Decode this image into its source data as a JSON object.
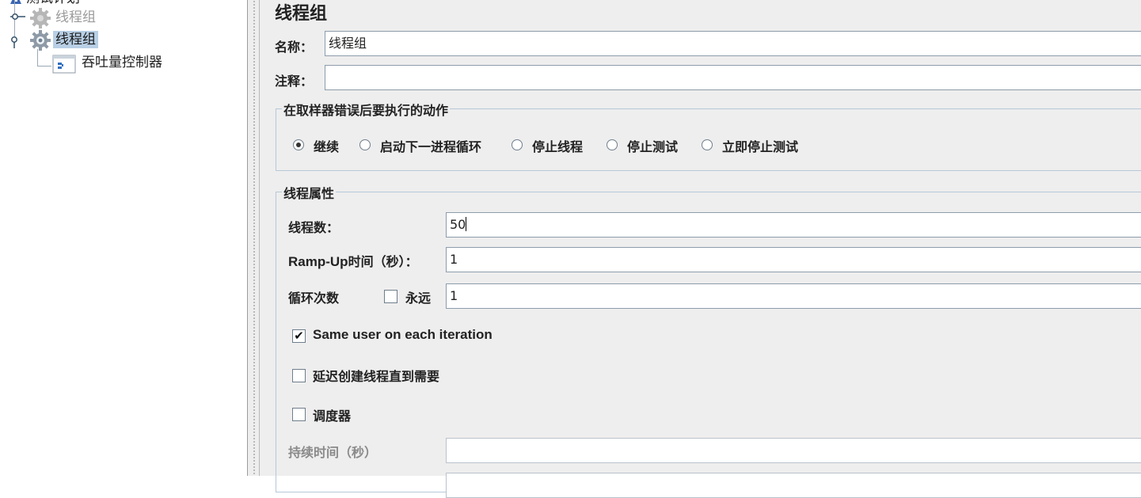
{
  "tree": {
    "test_plan": "测试计划",
    "items": [
      {
        "label": "线程组",
        "disabled": true
      },
      {
        "label": "线程组",
        "selected": true
      },
      {
        "label": "吞吐量控制器"
      }
    ]
  },
  "panel": {
    "title": "线程组",
    "name_label": "名称：",
    "name_value": "线程组",
    "comment_label": "注释：",
    "comment_value": "",
    "error_action": {
      "title": "在取样器错误后要执行的动作",
      "options": [
        "继续",
        "启动下一进程循环",
        "停止线程",
        "停止测试",
        "立即停止测试"
      ],
      "selected": "继续"
    },
    "thread_props": {
      "title": "线程属性",
      "threads_label": "线程数：",
      "threads_value": "50",
      "rampup_prefix": "Ramp-Up",
      "rampup_suffix": "时间（秒）：",
      "rampup_value": "1",
      "loop_label": "循环次数",
      "forever_label": "永远",
      "forever_checked": false,
      "loop_value": "1",
      "same_user_label": "Same user on each iteration",
      "same_user_checked": true,
      "delay_label": "延迟创建线程直到需要",
      "delay_checked": false,
      "scheduler_label": "调度器",
      "scheduler_checked": false,
      "duration_label": "持续时间（秒）",
      "duration_value": ""
    }
  },
  "icons": {
    "tree_expand": "tree-handle-icon",
    "gear": "gear-icon",
    "controller": "controller-icon",
    "checkmark": "✔"
  },
  "colors": {
    "panel_bg": "#eeeeee",
    "selected_bg": "#b8cfe5",
    "group_border": "#b7c8d8",
    "field_border": "#8d9cab"
  }
}
